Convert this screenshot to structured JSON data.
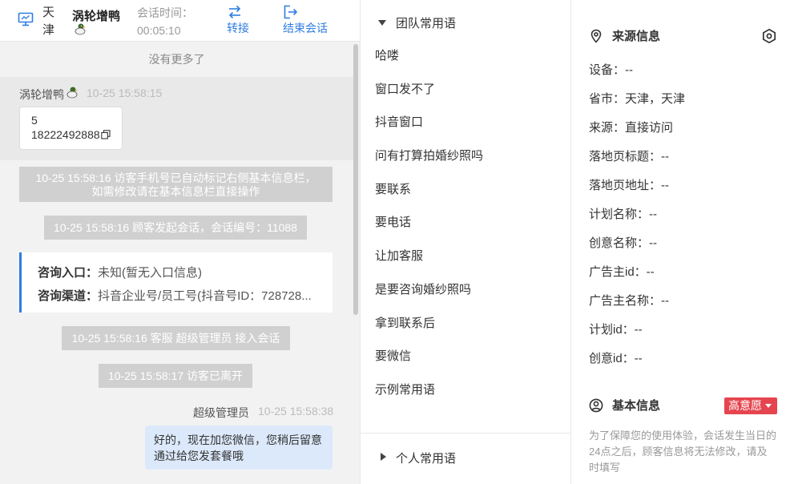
{
  "header": {
    "city": "天津",
    "visitor_name": "涡轮增鸭",
    "session_time_label": "会话时间：",
    "session_time": "00:05:10",
    "transfer_label": "转接",
    "end_label": "结束会话"
  },
  "chat": {
    "no_more": "没有更多了",
    "visitor_name": "涡轮增鸭",
    "visitor_time": "10-25 15:58:15",
    "visitor_msg_line1": "5",
    "visitor_msg_line2": "18222492888",
    "sys_auto_mark_line1": "10-25 15:58:16 访客手机号已自动标记右侧基本信息栏，",
    "sys_auto_mark_line2": "如需修改请在基本信息栏直接操作",
    "sys_session_start": "10-25 15:58:16 顾客发起会话，会话编号：11088",
    "consult_entry_label": "咨询入口：",
    "consult_entry_value": "未知(暂无入口信息)",
    "consult_channel_label": "咨询渠道：",
    "consult_channel_value": "抖音企业号/员工号(抖音号ID：728728...",
    "sys_agent_join": "10-25 15:58:16 客服 超级管理员 接入会话",
    "sys_visitor_left": "10-25 15:58:17 访客已离开",
    "agent_name": "超级管理员",
    "agent_time": "10-25 15:58:38",
    "agent_msg": "好的，现在加您微信，您稍后留意通过给您发套餐哦"
  },
  "phrases": {
    "team_group": "团队常用语",
    "items": [
      "哈喽",
      "窗口发不了",
      "抖音窗口",
      "问有打算拍婚纱照吗",
      "要联系",
      "要电话",
      "让加客服",
      "是要咨询婚纱照吗",
      "拿到联系后",
      "要微信",
      "示例常用语"
    ],
    "personal_group": "个人常用语"
  },
  "info": {
    "source_title": "来源信息",
    "rows": [
      "设备：--",
      "省市：天津，天津",
      "来源：直接访问",
      "落地页标题：--",
      "落地页地址：--",
      "计划名称：--",
      "创意名称：--",
      "广告主id：--",
      "广告主名称：--",
      "计划id：--",
      "创意id：--"
    ],
    "basic_title": "基本信息",
    "intent_badge": "高意愿",
    "basic_note": "为了保障您的使用体验，会话发生当日的24点之后，顾客信息将无法修改，请及时填写"
  },
  "colors": {
    "accent": "#2f7de1",
    "badge": "#e5454f",
    "agent_bubble": "#dce9fb",
    "system_msg": "#d0d0d0"
  },
  "icons": [
    "monitor-icon",
    "duck-avatar-icon",
    "transfer-icon",
    "logout-icon",
    "copy-icon",
    "caret-down-icon",
    "caret-right-icon",
    "location-icon",
    "settings-icon",
    "user-circle-icon"
  ]
}
